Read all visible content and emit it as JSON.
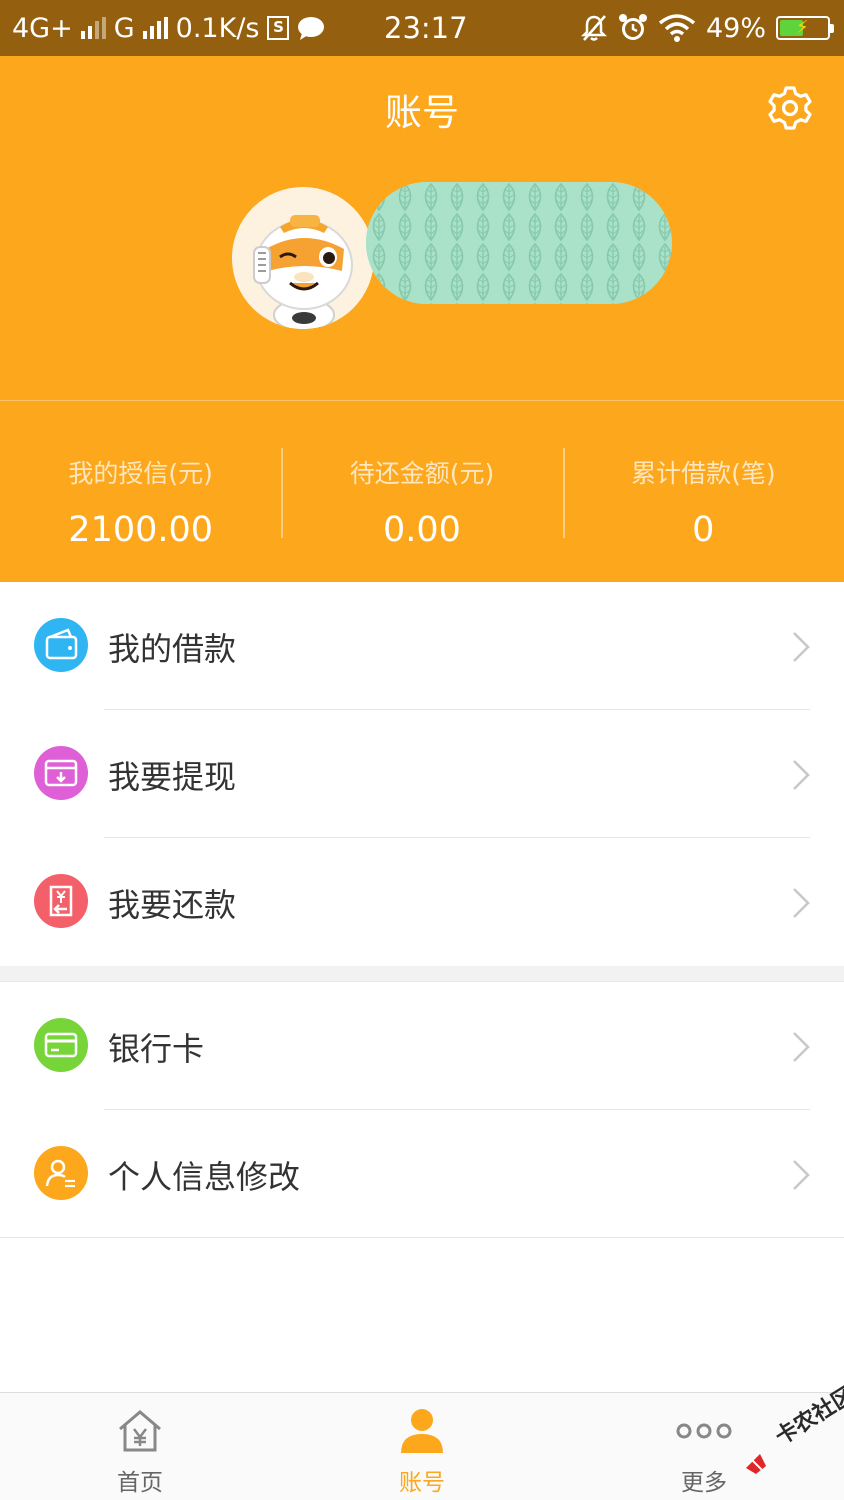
{
  "status_bar": {
    "network_1": "4G+",
    "network_2": "G",
    "speed": "0.1K/s",
    "sim_badge": "S",
    "time": "23:17",
    "battery": "49%",
    "icons": [
      "signal-icon",
      "sim-icon",
      "chat-bubble-icon",
      "bell-off-icon",
      "alarm-icon",
      "wifi-icon",
      "battery-icon"
    ]
  },
  "header": {
    "title": "账号",
    "settings_icon": "gear-icon",
    "background_color": "#fca71c"
  },
  "stats": [
    {
      "label": "我的授信(元)",
      "value": "2100.00"
    },
    {
      "label": "待还金额(元)",
      "value": "0.00"
    },
    {
      "label": "累计借款(笔)",
      "value": "0"
    }
  ],
  "menu_group_1": [
    {
      "label": "我的借款",
      "icon": "wallet-icon",
      "color": "#2fb6f2"
    },
    {
      "label": "我要提现",
      "icon": "withdraw-icon",
      "color": "#df5fd6"
    },
    {
      "label": "我要还款",
      "icon": "repay-icon",
      "color": "#f4606a"
    }
  ],
  "menu_group_2": [
    {
      "label": "银行卡",
      "icon": "bank-card-icon",
      "color": "#77d53a"
    },
    {
      "label": "个人信息修改",
      "icon": "user-edit-icon",
      "color": "#fca71c"
    }
  ],
  "tab_bar": [
    {
      "label": "首页",
      "icon": "home-yen-icon",
      "active": false
    },
    {
      "label": "账号",
      "icon": "user-icon",
      "active": true
    },
    {
      "label": "更多",
      "icon": "more-dots-icon",
      "active": false
    }
  ],
  "watermark": {
    "text": "卡农社区"
  },
  "colors": {
    "accent": "#fca71c",
    "status_bar": "#94600f"
  }
}
